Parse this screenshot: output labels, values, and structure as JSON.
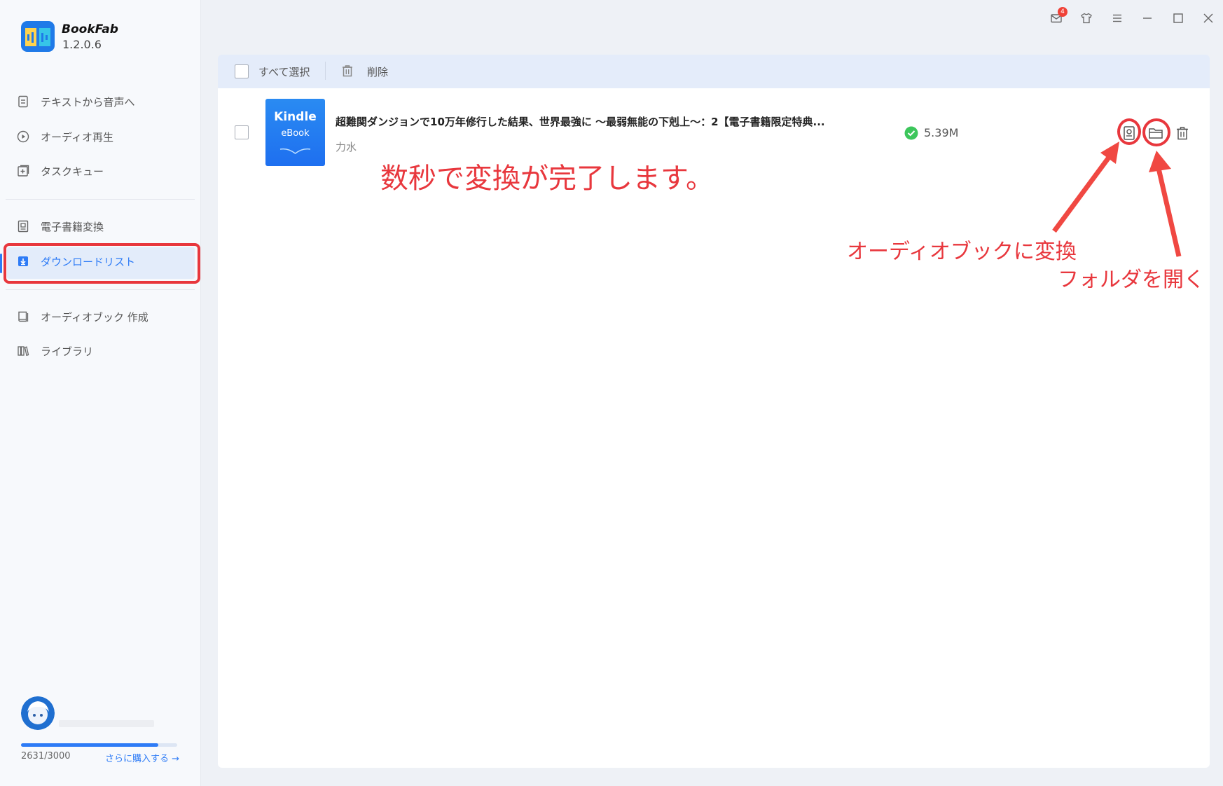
{
  "app": {
    "name": "BookFab",
    "version": "1.2.0.6"
  },
  "sidebar": {
    "items": [
      {
        "label": "テキストから音声へ",
        "icon": "document-icon"
      },
      {
        "label": "オーディオ再生",
        "icon": "play-circle-icon"
      },
      {
        "label": "タスクキュー",
        "icon": "queue-add-icon"
      },
      {
        "label": "電子書籍変換",
        "icon": "ebook-icon"
      },
      {
        "label": "ダウンロードリスト",
        "icon": "download-icon",
        "active": true
      },
      {
        "label": "オーディオブック 作成",
        "icon": "book-icon"
      },
      {
        "label": "ライブラリ",
        "icon": "library-icon"
      }
    ]
  },
  "account": {
    "quota_text": "2631/3000",
    "quota_used_fraction": 0.877,
    "buy_label": "さらに購入する →"
  },
  "window_controls": {
    "mail_badge": "4"
  },
  "toolbar": {
    "select_all_label": "すべて選択",
    "delete_label": "削除"
  },
  "downloads": [
    {
      "cover_title": "Kindle",
      "cover_subtitle": "eBook",
      "title": "超難関ダンジョンで10万年修行した結果、世界最強に ～最弱無能の下剋上～：2【電子書籍限定特典...",
      "author": "力水",
      "size": "5.39M",
      "status": "complete"
    }
  ],
  "annotations": {
    "main_note": "数秒で変換が完了します。",
    "convert_note": "オーディオブックに変換",
    "folder_note": "フォルダを開く"
  },
  "colors": {
    "accent": "#2d7bf6",
    "annotation_red": "#e8373d",
    "success_green": "#3cc65b"
  }
}
